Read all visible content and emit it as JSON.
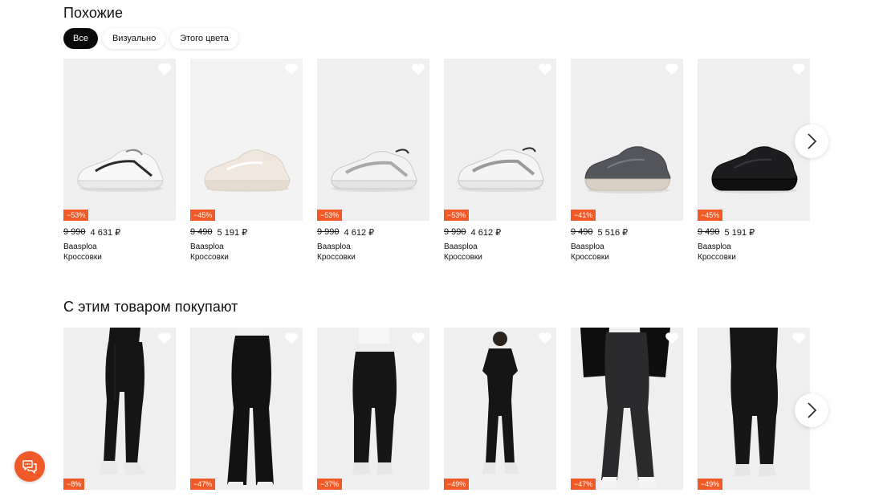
{
  "similar": {
    "title": "Похожие",
    "filters": [
      {
        "label": "Все",
        "active": true
      },
      {
        "label": "Визуально",
        "active": false
      },
      {
        "label": "Этого цвета",
        "active": false
      }
    ],
    "products": [
      {
        "discount": "−53%",
        "old_price": "9 990",
        "price": "4 631 ₽",
        "brand": "Baasploa",
        "type": "Кроссовки",
        "color": "white-black"
      },
      {
        "discount": "−45%",
        "old_price": "9 490",
        "price": "5 191 ₽",
        "brand": "Baasploa",
        "type": "Кроссовки",
        "color": "cream"
      },
      {
        "discount": "−53%",
        "old_price": "9 990",
        "price": "4 612 ₽",
        "brand": "Baasploa",
        "type": "Кроссовки",
        "color": "white-grey"
      },
      {
        "discount": "−53%",
        "old_price": "9 990",
        "price": "4 612 ₽",
        "brand": "Baasploa",
        "type": "Кроссовки",
        "color": "white-grey"
      },
      {
        "discount": "−41%",
        "old_price": "9 490",
        "price": "5 516 ₽",
        "brand": "Baasploa",
        "type": "Кроссовки",
        "color": "dark-grey"
      },
      {
        "discount": "−45%",
        "old_price": "9 490",
        "price": "5 191 ₽",
        "brand": "Baasploa",
        "type": "Кроссовки",
        "color": "black"
      }
    ]
  },
  "bought_with": {
    "title": "С этим товаром покупают",
    "products": [
      {
        "discount": "−8%",
        "item": "leggings"
      },
      {
        "discount": "−47%",
        "item": "flared-pants"
      },
      {
        "discount": "−37%",
        "item": "joggers"
      },
      {
        "discount": "−49%",
        "item": "jumpsuit"
      },
      {
        "discount": "−47%",
        "item": "jeans"
      },
      {
        "discount": "−49%",
        "item": "trousers"
      }
    ]
  },
  "icons": {
    "favorite": "heart-icon",
    "next": "chevron-right-icon",
    "chat": "chat-icon"
  },
  "colors": {
    "accent": "#f05a28",
    "chip_active": "#0b0b0b"
  }
}
